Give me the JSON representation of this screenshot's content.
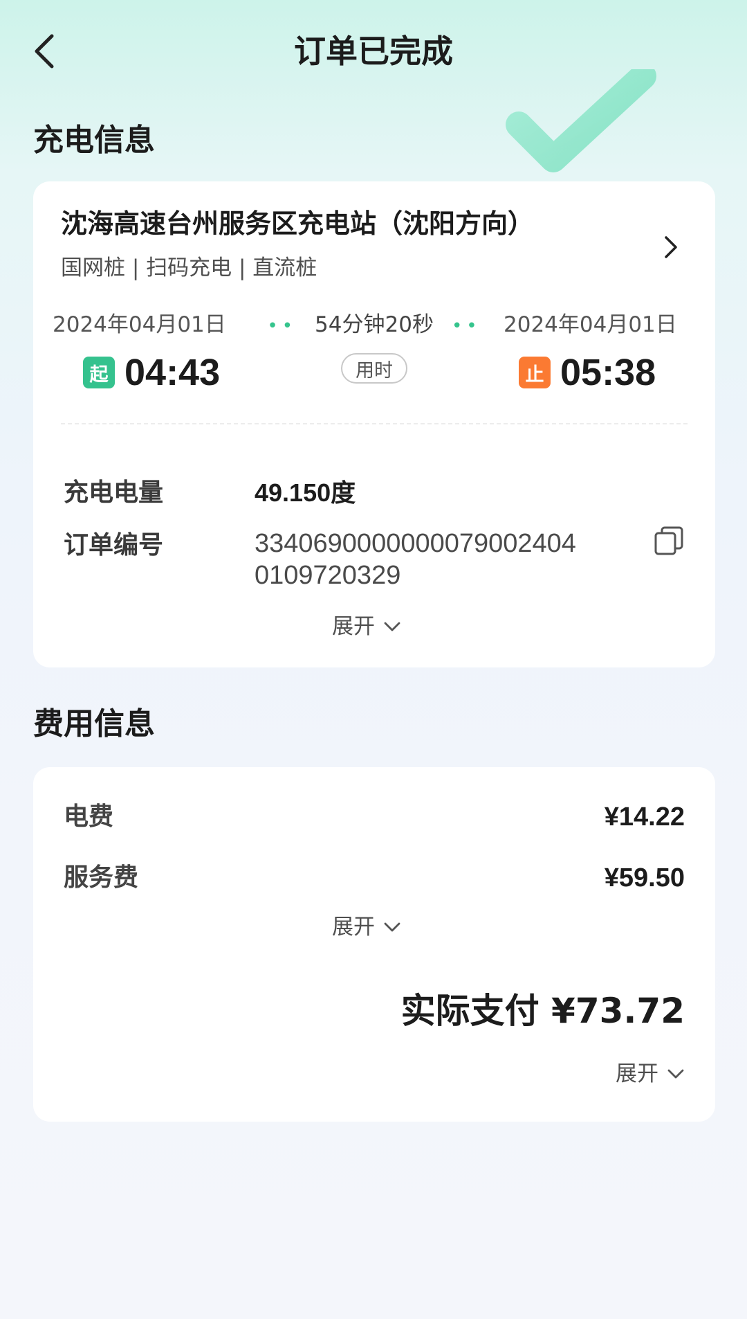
{
  "header": {
    "title": "订单已完成"
  },
  "charging_section": {
    "title": "充电信息",
    "station_name": "沈海高速台州服务区充电站（沈阳方向）",
    "station_tags": "国网桩 | 扫码充电 | 直流桩",
    "start_date": "2024年04月01日",
    "start_badge": "起",
    "start_time": "04:43",
    "duration": "54分钟20秒",
    "duration_label": "用时",
    "end_date": "2024年04月01日",
    "end_badge": "止",
    "end_time": "05:38",
    "energy_label": "充电电量",
    "energy_value": "49.150度",
    "order_label": "订单编号",
    "order_value": "33406900000000790024040109720329",
    "expand_label": "展开"
  },
  "fee_section": {
    "title": "费用信息",
    "electricity_label": "电费",
    "electricity_value": "¥14.22",
    "service_label": "服务费",
    "service_value": "¥59.50",
    "expand_label": "展开",
    "total_text": "实际支付 ¥73.72",
    "total_expand_label": "展开"
  },
  "colors": {
    "accent_green": "#35c28e",
    "accent_orange": "#fb7a32"
  }
}
